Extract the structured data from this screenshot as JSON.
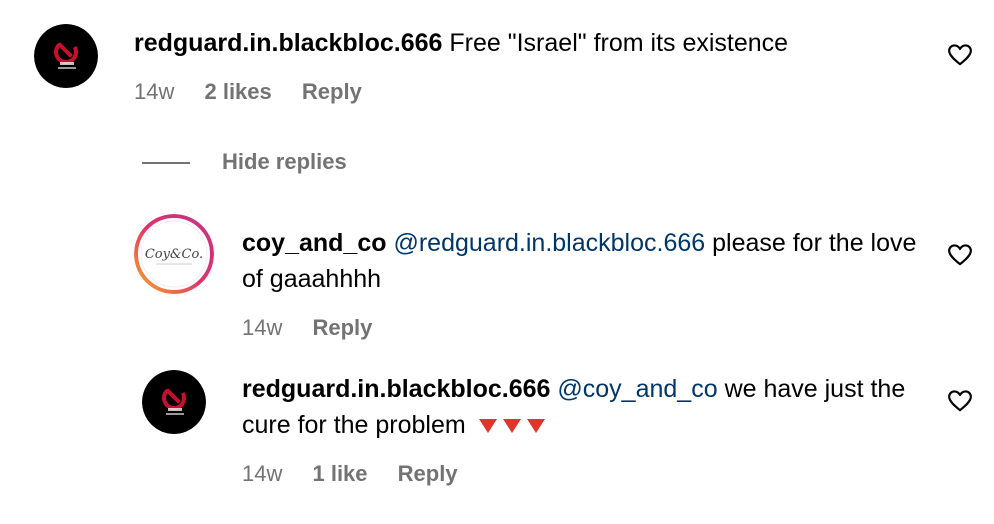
{
  "comments": [
    {
      "username": "redguard.in.blackbloc.666",
      "mention": "",
      "text": "Free \"Israel\" from its existence",
      "time": "14w",
      "likes": "2 likes",
      "reply": "Reply",
      "avatar": "redguard-avatar"
    },
    {
      "username": "coy_and_co",
      "mention": "@redguard.in.blackbloc.666",
      "text": "please for the love of gaaahhhh",
      "time": "14w",
      "likes": "",
      "reply": "Reply",
      "avatar": "coy-and-co-avatar",
      "avatar_text": "Coy&Co."
    },
    {
      "username": "redguard.in.blackbloc.666",
      "mention": "@coy_and_co",
      "text": "we have just the cure for the problem",
      "emoji": "🔻🔻🔻",
      "time": "14w",
      "likes": "1 like",
      "reply": "Reply",
      "avatar": "redguard-avatar"
    }
  ],
  "hide_replies_label": "Hide replies",
  "icons": {
    "like": "heart-outline-icon",
    "reaction": "red-down-triangle-icon"
  },
  "colors": {
    "text": "#000000",
    "secondary": "#737373",
    "mention": "#00376b",
    "triangle": "#e0352b"
  }
}
